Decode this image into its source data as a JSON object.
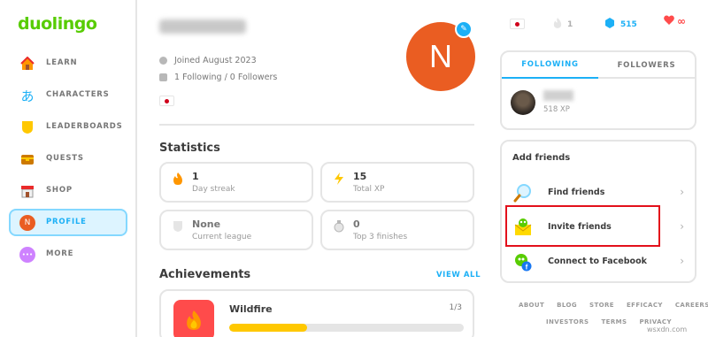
{
  "app": {
    "logo": "duolingo"
  },
  "sidebar": {
    "items": [
      {
        "label": "LEARN",
        "icon": "house-icon"
      },
      {
        "label": "CHARACTERS",
        "icon": "hiragana-icon",
        "glyph": "あ"
      },
      {
        "label": "LEADERBOARDS",
        "icon": "shield-icon"
      },
      {
        "label": "QUESTS",
        "icon": "chest-icon"
      },
      {
        "label": "SHOP",
        "icon": "shop-icon"
      },
      {
        "label": "PROFILE",
        "icon": "avatar-icon",
        "glyph": "N",
        "active": true
      },
      {
        "label": "MORE",
        "icon": "more-icon",
        "glyph": "•••"
      }
    ]
  },
  "profile": {
    "joined": "Joined August 2023",
    "follow_counts": "1 Following / 0 Followers",
    "avatar_letter": "N",
    "avatar_color": "#ea5d22"
  },
  "statistics": {
    "title": "Statistics",
    "cards": [
      {
        "value": "1",
        "label": "Day streak",
        "icon": "flame-icon"
      },
      {
        "value": "15",
        "label": "Total XP",
        "icon": "lightning-icon"
      },
      {
        "value": "None",
        "label": "Current league",
        "icon": "shield-icon"
      },
      {
        "value": "0",
        "label": "Top 3 finishes",
        "icon": "medal-icon"
      }
    ]
  },
  "achievements": {
    "title": "Achievements",
    "view_all": "VIEW ALL",
    "items": [
      {
        "name": "Wildfire",
        "progress_text": "1/3",
        "progress": 0.333,
        "icon": "wildfire-icon"
      }
    ]
  },
  "topbar": {
    "streak": "1",
    "gems": "515",
    "hearts": "∞"
  },
  "friends": {
    "tabs": [
      "FOLLOWING",
      "FOLLOWERS"
    ],
    "active_tab": 0,
    "list": [
      {
        "xp": "518 XP"
      }
    ]
  },
  "add_friends": {
    "title": "Add friends",
    "items": [
      {
        "label": "Find friends",
        "icon": "magnifier-icon"
      },
      {
        "label": "Invite friends",
        "icon": "envelope-owl-icon",
        "highlighted": true
      },
      {
        "label": "Connect to Facebook",
        "icon": "facebook-icon"
      }
    ]
  },
  "footer": {
    "row1": [
      "ABOUT",
      "BLOG",
      "STORE",
      "EFFICACY",
      "CAREERS"
    ],
    "row2": [
      "INVESTORS",
      "TERMS",
      "PRIVACY"
    ]
  },
  "watermark": "wsxdn.com",
  "colors": {
    "brand": "#58cc02",
    "accent_blue": "#1cb0f6",
    "highlight_red": "#e3101b"
  }
}
